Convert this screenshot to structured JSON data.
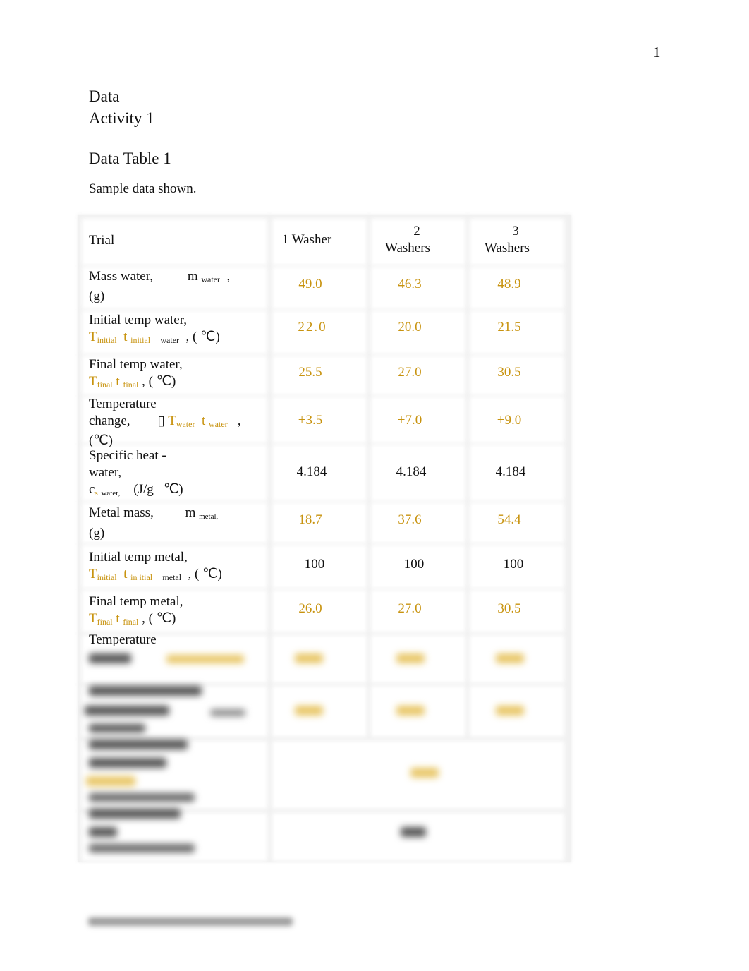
{
  "page_number": "1",
  "headings": {
    "section": "Data",
    "activity": "Activity 1",
    "table_title": "Data Table 1",
    "note": "Sample data shown."
  },
  "table": {
    "header": {
      "label": "Trial",
      "col1": "1 Washer",
      "col2_a": "2",
      "col2_b": "Washers",
      "col3_a": "3",
      "col3_b": "Washers"
    },
    "rows": [
      {
        "label_line1": "Mass water,",
        "symbol": "m",
        "symbol_sub": "water",
        "label_line2": "(g)",
        "values": [
          "49.0",
          "46.3",
          "48.9"
        ]
      },
      {
        "label_line1": "Initial temp water,",
        "sym_T": "T",
        "sym_T_sub": "initial",
        "sym_t": "t",
        "sym_t_sub": "initial",
        "extra_sub": "water",
        "unit": ", ( ℃)",
        "values": [
          "22.0",
          "20.0",
          "21.5"
        ]
      },
      {
        "label_line1": "Final temp water,",
        "sym_T": "T",
        "sym_T_sub": "final",
        "sym_t": "t",
        "sym_t_sub": "final",
        "unit": ", ( ℃)",
        "values": [
          "25.5",
          "27.0",
          "30.5"
        ]
      },
      {
        "label_line1": "Temperature",
        "label_line2": "change,",
        "delta": "▯",
        "sym_T": "T",
        "sym_T_sub": "water",
        "sym_t": "t",
        "sym_t_sub": "water",
        "comma": ",",
        "label_line3": "(℃)",
        "values": [
          "+3.5",
          "+7.0",
          "+9.0"
        ]
      },
      {
        "label_line1": "Specific heat -",
        "label_line2": "water,",
        "sym_c": "c",
        "sym_c_sub1": "s",
        "sym_c_sub2": "water,",
        "unit": "(J/g   ℃)",
        "values": [
          "4.184",
          "4.184",
          "4.184"
        ]
      },
      {
        "label_line1": "Metal mass,",
        "symbol": "m",
        "symbol_sub": "metal,",
        "label_line2": "(g)",
        "values": [
          "18.7",
          "37.6",
          "54.4"
        ]
      },
      {
        "label_line1": "Initial temp metal,",
        "sym_T": "T",
        "sym_T_sub": "initial",
        "sym_t": "t",
        "sym_t_sub": "in itial",
        "extra_sub": "metal",
        "unit": ", ( ℃)",
        "values": [
          "100",
          "100",
          "100"
        ]
      },
      {
        "label_line1": "Final temp metal,",
        "sym_T": "T",
        "sym_T_sub": "final",
        "sym_t": "t",
        "sym_t_sub": "final",
        "unit": ", ( ℃)",
        "values": [
          "26.0",
          "27.0",
          "30.5"
        ]
      },
      {
        "label_line1": "Temperature"
      }
    ]
  }
}
